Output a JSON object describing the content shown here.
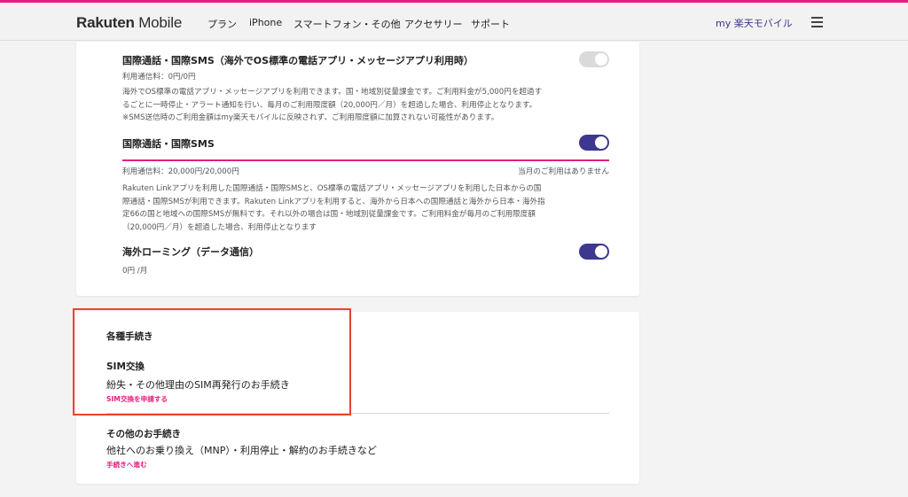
{
  "header": {
    "logo_main": "Rakuten",
    "logo_sub": "Mobile",
    "nav": [
      "プラン",
      "iPhone",
      "スマートフォン・その他",
      "アクセサリー",
      "サポート"
    ],
    "my_link": "my 楽天モバイル",
    "accent": "#e61e7f",
    "brand": "#3d3790"
  },
  "services": [
    {
      "title": "国際通話・国際SMS（海外でOS標準の電話アプリ・メッセージアプリ利用時）",
      "usage": "利用通信料：0円/0円",
      "toggle_on": false,
      "desc": [
        "海外でOS標準の電話アプリ・メッセージアプリを利用できます。国・地域別従量課金です。ご利用料金が5,000円を超過す",
        "るごとに一時停止・アラート通知を行い、毎月のご利用限度額（20,000円／月）を超過した場合、利用停止となります。",
        "※SMS送信時のご利用金額はmy楽天モバイルに反映されず、ご利用限度額に加算されない可能性があります。"
      ]
    },
    {
      "title": "国際通話・国際SMS",
      "usage": "利用通信料：20,000円/20,000円",
      "usage_note": "当月のご利用はありません",
      "toggle_on": true,
      "usage_fraction": 1.0,
      "desc": [
        "Rakuten Linkアプリを利用した国際通話・国際SMSと、OS標準の電話アプリ・メッセージアプリを利用した日本からの国",
        "際通話・国際SMSが利用できます。Rakuten Linkアプリを利用すると、海外から日本への国際通話と海外から日本・海外指",
        "定66の国と地域への国際SMSが無料です。それ以外の場合は国・地域別従量課金です。ご利用料金が毎月のご利用限度額",
        "（20,000円／月）を超過した場合、利用停止となります"
      ]
    },
    {
      "title": "海外ローミング（データ通信）",
      "usage": "0円 /月",
      "toggle_on": true
    }
  ],
  "procedures": {
    "heading": "各種手続き",
    "items": [
      {
        "title": "SIM交換",
        "desc": "紛失・その他理由のSIM再発行のお手続き",
        "link": "SIM交換を申請する"
      },
      {
        "title": "その他のお手続き",
        "desc": "他社へのお乗り換え（MNP）・利用停止・解約のお手続きなど",
        "link": "手続きへ進む"
      }
    ]
  }
}
